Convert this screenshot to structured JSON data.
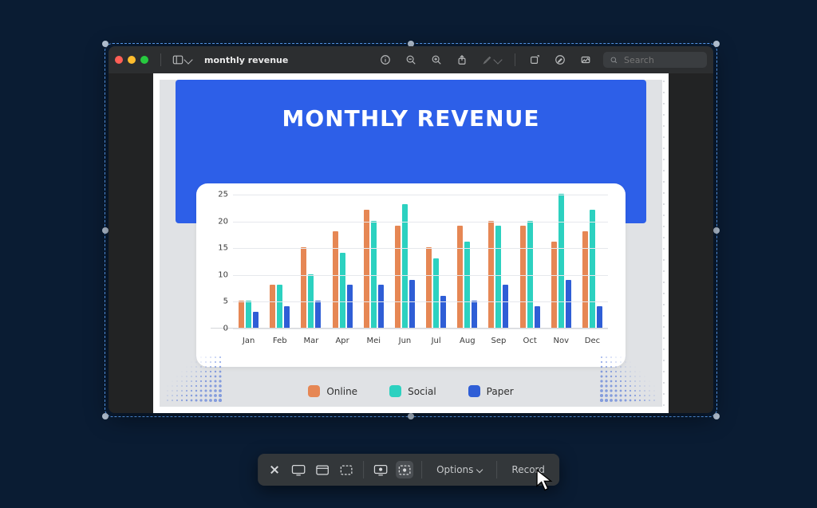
{
  "window": {
    "title": "monthly revenue"
  },
  "search": {
    "placeholder": "Search"
  },
  "slide": {
    "title": "MONTHLY REVENUE"
  },
  "legend": {
    "online": "Online",
    "social": "Social",
    "paper": "Paper"
  },
  "screenshot_bar": {
    "options": "Options",
    "record": "Record"
  },
  "chart_data": {
    "type": "bar",
    "title": "MONTHLY REVENUE",
    "xlabel": "",
    "ylabel": "",
    "ylim": [
      0,
      25
    ],
    "yticks": [
      0,
      5,
      10,
      15,
      20,
      25
    ],
    "categories": [
      "Jan",
      "Feb",
      "Mar",
      "Apr",
      "Mei",
      "Jun",
      "Jul",
      "Aug",
      "Sep",
      "Oct",
      "Nov",
      "Dec"
    ],
    "series": [
      {
        "name": "Online",
        "color": "#e68754",
        "values": [
          5,
          8,
          15,
          18,
          22,
          19,
          15,
          19,
          20,
          19,
          16,
          18
        ]
      },
      {
        "name": "Social",
        "color": "#2cd1c0",
        "values": [
          5,
          8,
          10,
          14,
          20,
          23,
          13,
          16,
          19,
          20,
          25,
          22
        ]
      },
      {
        "name": "Paper",
        "color": "#2f5ed6",
        "values": [
          3,
          4,
          5,
          8,
          8,
          9,
          6,
          5,
          8,
          4,
          9,
          4
        ]
      }
    ]
  }
}
